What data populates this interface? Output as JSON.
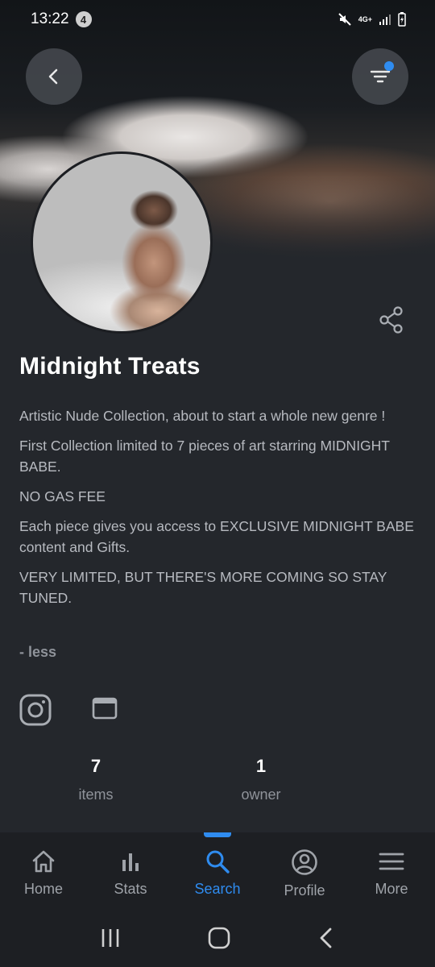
{
  "status_bar": {
    "time": "13:22",
    "notification_count": "4",
    "network": "4G+"
  },
  "collection": {
    "name": "Midnight Treats",
    "description": [
      "Artistic Nude Collection, about to start a whole new genre !",
      "First Collection limited to 7 pieces of art starring MIDNIGHT BABE.",
      "NO GAS FEE",
      "Each piece gives you access to EXCLUSIVE MIDNIGHT BABE content and Gifts.",
      "VERY LIMITED, BUT THERE'S MORE COMING SO STAY TUNED."
    ],
    "toggle_label": "- less"
  },
  "stats": {
    "items_count": "7",
    "items_label": "items",
    "owners_count": "1",
    "owners_label": "owner"
  },
  "bottom_nav": {
    "items": [
      {
        "label": "Home",
        "icon": "home-icon"
      },
      {
        "label": "Stats",
        "icon": "stats-icon"
      },
      {
        "label": "Search",
        "icon": "search-icon",
        "active": true
      },
      {
        "label": "Profile",
        "icon": "profile-icon"
      },
      {
        "label": "More",
        "icon": "menu-icon"
      }
    ]
  },
  "colors": {
    "background": "#24272c",
    "accent": "#2f8cf0",
    "nav_background": "#1d1f23",
    "muted_text": "#8f939a"
  }
}
